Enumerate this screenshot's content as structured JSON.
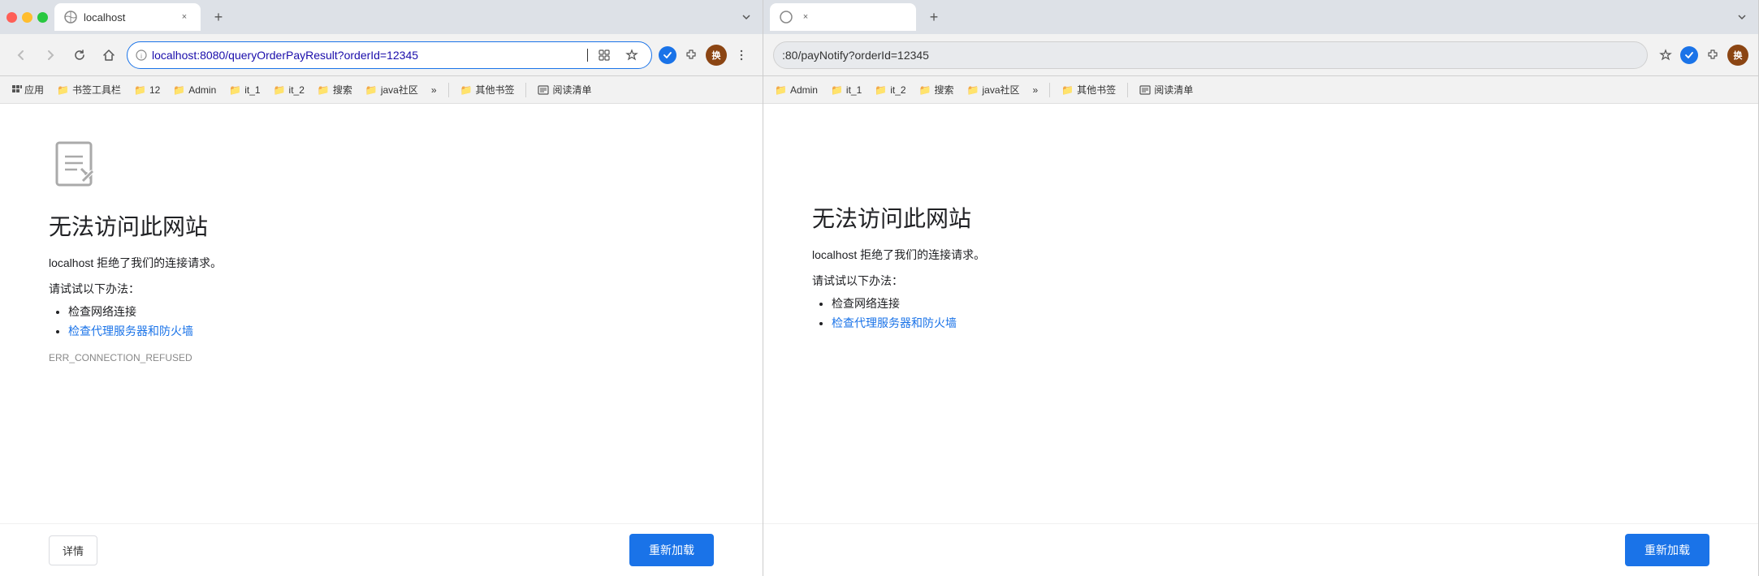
{
  "left_window": {
    "tab": {
      "favicon": "🌐",
      "title": "localhost",
      "close_label": "×"
    },
    "new_tab_label": "+",
    "nav": {
      "back_label": "←",
      "forward_label": "→",
      "refresh_label": "↻",
      "home_label": "⌂",
      "address": "localhost:8080/queryOrderPayResult?orderId=12345",
      "address_display": "localhost:8080/queryOrderPayResult?orderId=12345"
    },
    "bookmarks": {
      "apps_label": "应用",
      "items": [
        {
          "icon": "📁",
          "label": "书签工具栏"
        },
        {
          "icon": "📁",
          "label": "12"
        },
        {
          "icon": "📁",
          "label": "Admin"
        },
        {
          "icon": "📁",
          "label": "it_1"
        },
        {
          "icon": "📁",
          "label": "it_2"
        },
        {
          "icon": "📁",
          "label": "搜索"
        },
        {
          "icon": "📁",
          "label": "java社区"
        }
      ],
      "more_label": "»",
      "separator_label": "|",
      "other_label": "其他书签",
      "reading_label": "阅读清单"
    },
    "error": {
      "title": "无法访问此网站",
      "description_prefix": "localhost",
      "description_suffix": " 拒绝了我们的连接请求。",
      "subtitle": "请试试以下办法：",
      "list_items": [
        {
          "text": "检查网络连接",
          "link": false
        },
        {
          "text": "检查代理服务器和防火墙",
          "link": true
        }
      ],
      "error_code": "ERR_CONNECTION_REFUSED"
    },
    "footer": {
      "details_label": "详情",
      "reload_label": "重新加载"
    }
  },
  "right_window": {
    "tab": {
      "title": "",
      "close_label": "×"
    },
    "new_tab_label": "+",
    "nav": {
      "address": ":80/payNotify?orderId=12345",
      "address_display": ":80/payNotify?orderId=12345"
    },
    "bookmarks": {
      "items": [
        {
          "icon": "📁",
          "label": "Admin"
        },
        {
          "icon": "📁",
          "label": "it_1"
        },
        {
          "icon": "📁",
          "label": "it_2"
        },
        {
          "icon": "📁",
          "label": "搜索"
        },
        {
          "icon": "📁",
          "label": "java社区"
        }
      ],
      "more_label": "»",
      "other_label": "其他书签",
      "reading_label": "阅读清单"
    },
    "error": {
      "description_suffix": "请求。",
      "list_item_partial": "墙",
      "error_code": ""
    },
    "footer": {
      "reload_label": "重新加载"
    }
  },
  "icons": {
    "error_page": "📄",
    "check": "✓",
    "star": "★",
    "puzzle": "🧩",
    "more": "⋮",
    "folder": "📁",
    "grid": "⊞"
  }
}
